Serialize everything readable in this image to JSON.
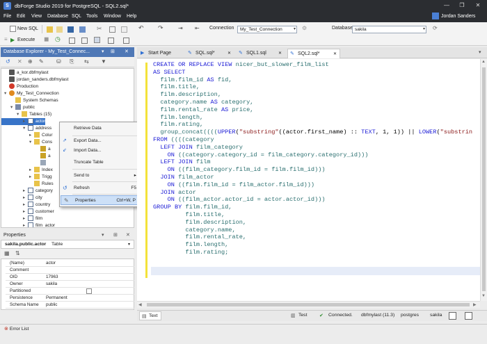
{
  "window": {
    "title": "dbForge Studio 2019 for PostgreSQL - SQL2.sql*",
    "app_icon": "S",
    "controls": [
      "—",
      "❐",
      "✕"
    ]
  },
  "menu": [
    "File",
    "Edit",
    "View",
    "Database",
    "SQL",
    "Tools",
    "Window",
    "Help"
  ],
  "user": {
    "name": "Jordan Sanders"
  },
  "toolbar": {
    "new_sql": "New SQL",
    "execute": "Execute",
    "connection_label": "Connection",
    "connection_value": "My_Test_Connection",
    "database_label": "Database",
    "database_value": "sakila"
  },
  "explorer": {
    "title": "Database Explorer - My_Test_Connec...",
    "tree": [
      {
        "label": "a_kor.dbfmylast",
        "indent": 0,
        "icon": "server",
        "expand": ""
      },
      {
        "label": "jordan_sanders.dbfmylast",
        "indent": 0,
        "icon": "server",
        "expand": ""
      },
      {
        "label": "Production",
        "indent": 0,
        "icon": "server-red",
        "expand": ""
      },
      {
        "label": "My_Test_Connection",
        "indent": 0,
        "icon": "server-orange",
        "expand": "▾"
      },
      {
        "label": "System Schemas",
        "indent": 1,
        "icon": "folder",
        "expand": ""
      },
      {
        "label": "public",
        "indent": 1,
        "icon": "schema",
        "expand": "▾"
      },
      {
        "label": "Tables (15)",
        "indent": 2,
        "icon": "folder",
        "expand": "▾"
      },
      {
        "label": "actor",
        "indent": 3,
        "icon": "table",
        "expand": "▸",
        "selected": true
      },
      {
        "label": "address",
        "indent": 3,
        "icon": "table",
        "expand": "▾"
      },
      {
        "label": "Colur",
        "indent": 4,
        "icon": "folder",
        "expand": "▸"
      },
      {
        "label": "Cons",
        "indent": 4,
        "icon": "folder",
        "expand": "▾"
      },
      {
        "label": "a",
        "indent": 5,
        "icon": "key",
        "expand": ""
      },
      {
        "label": "a",
        "indent": 5,
        "icon": "key",
        "expand": ""
      },
      {
        "label": "",
        "indent": 5,
        "icon": "fk",
        "expand": ""
      },
      {
        "label": "Index",
        "indent": 4,
        "icon": "folder",
        "expand": "▸"
      },
      {
        "label": "Trigg",
        "indent": 4,
        "icon": "folder",
        "expand": "▸"
      },
      {
        "label": "Rules",
        "indent": 4,
        "icon": "folder",
        "expand": ""
      },
      {
        "label": "category",
        "indent": 3,
        "icon": "table",
        "expand": "▸"
      },
      {
        "label": "city",
        "indent": 3,
        "icon": "table",
        "expand": "▸"
      },
      {
        "label": "country",
        "indent": 3,
        "icon": "table",
        "expand": "▸"
      },
      {
        "label": "customer",
        "indent": 3,
        "icon": "table",
        "expand": "▸"
      },
      {
        "label": "film",
        "indent": 3,
        "icon": "table",
        "expand": "▸"
      },
      {
        "label": "film_actor",
        "indent": 3,
        "icon": "table",
        "expand": "▸"
      }
    ]
  },
  "context_menu": [
    {
      "label": "Retrieve Data",
      "shortcut": ""
    },
    {
      "label": "Export Data...",
      "shortcut": ""
    },
    {
      "label": "Import Data...",
      "shortcut": ""
    },
    {
      "label": "Truncate Table",
      "shortcut": ""
    },
    {
      "label": "Send to",
      "shortcut": "▸"
    },
    {
      "label": "Refresh",
      "shortcut": "F5"
    },
    {
      "label": "Properties",
      "shortcut": "Ctrl+W, P"
    }
  ],
  "properties": {
    "title": "Properties",
    "object": "sakila.public.actor",
    "object_type": "Table",
    "rows": [
      {
        "key": "(Name)",
        "value": "actor"
      },
      {
        "key": "Comment",
        "value": ""
      },
      {
        "key": "OID",
        "value": "17963"
      },
      {
        "key": "Owner",
        "value": "sakila"
      },
      {
        "key": "Partitioned",
        "value": ""
      },
      {
        "key": "Persistence",
        "value": "Permanent"
      },
      {
        "key": "Schema Name",
        "value": "public"
      }
    ]
  },
  "tabs": [
    {
      "label": "Start Page",
      "active": false
    },
    {
      "label": "SQL.sql*",
      "active": false
    },
    {
      "label": "SQL1.sql",
      "active": false
    },
    {
      "label": "SQL2.sql*",
      "active": true
    }
  ],
  "code_lines": [
    [
      [
        "kw",
        "CREATE OR REPLACE VIEW "
      ],
      [
        "ct",
        "nicer_but_slower_film_list"
      ]
    ],
    [
      [
        "kw",
        "AS SELECT"
      ]
    ],
    [
      [
        "id",
        "  "
      ],
      [
        "ct",
        "film.film_id "
      ],
      [
        "kw",
        "AS "
      ],
      [
        "ct",
        "fid,"
      ]
    ],
    [
      [
        "id",
        "  "
      ],
      [
        "ct",
        "film.title,"
      ]
    ],
    [
      [
        "id",
        "  "
      ],
      [
        "ct",
        "film.description,"
      ]
    ],
    [
      [
        "id",
        "  "
      ],
      [
        "ct",
        "category.name "
      ],
      [
        "kw",
        "AS "
      ],
      [
        "ct",
        "category,"
      ]
    ],
    [
      [
        "id",
        "  "
      ],
      [
        "ct",
        "film.rental_rate "
      ],
      [
        "kw",
        "AS "
      ],
      [
        "ct",
        "price,"
      ]
    ],
    [
      [
        "id",
        "  "
      ],
      [
        "ct",
        "film.length,"
      ]
    ],
    [
      [
        "id",
        "  "
      ],
      [
        "ct",
        "film.rating,"
      ]
    ],
    [
      [
        "id",
        "  "
      ],
      [
        "ct",
        "group_concat(((("
      ],
      [
        "kw",
        "UPPER"
      ],
      [
        "id",
        "("
      ],
      [
        "st",
        "\"substring\""
      ],
      [
        "id",
        "((actor.first_name) :: "
      ],
      [
        "kw",
        "TEXT"
      ],
      [
        "id",
        ", 1, 1)) || "
      ],
      [
        "kw",
        "LOWER"
      ],
      [
        "id",
        "("
      ],
      [
        "st",
        "\"substrin"
      ]
    ],
    [
      [
        "kw",
        "FROM "
      ],
      [
        "ct",
        "((((category"
      ]
    ],
    [
      [
        "id",
        "  "
      ],
      [
        "kw",
        "LEFT JOIN "
      ],
      [
        "ct",
        "film_category"
      ]
    ],
    [
      [
        "id",
        "    "
      ],
      [
        "kw",
        "ON "
      ],
      [
        "ct",
        "((category.category_id = film_category.category_id)))"
      ]
    ],
    [
      [
        "id",
        "  "
      ],
      [
        "kw",
        "LEFT JOIN "
      ],
      [
        "ct",
        "film"
      ]
    ],
    [
      [
        "id",
        "    "
      ],
      [
        "kw",
        "ON "
      ],
      [
        "ct",
        "((film_category.film_id = film.film_id)))"
      ]
    ],
    [
      [
        "id",
        "  "
      ],
      [
        "kw",
        "JOIN "
      ],
      [
        "ct",
        "film_actor"
      ]
    ],
    [
      [
        "id",
        "    "
      ],
      [
        "kw",
        "ON "
      ],
      [
        "ct",
        "((film.film_id = film_actor.film_id)))"
      ]
    ],
    [
      [
        "id",
        "  "
      ],
      [
        "kw",
        "JOIN "
      ],
      [
        "ct",
        "actor"
      ]
    ],
    [
      [
        "id",
        "    "
      ],
      [
        "kw",
        "ON "
      ],
      [
        "ct",
        "((film_actor.actor_id = actor.actor_id)))"
      ]
    ],
    [
      [
        "kw",
        "GROUP BY "
      ],
      [
        "ct",
        "film.film_id,"
      ]
    ],
    [
      [
        "id",
        "         "
      ],
      [
        "ct",
        "film.title,"
      ]
    ],
    [
      [
        "id",
        "         "
      ],
      [
        "ct",
        "film.description,"
      ]
    ],
    [
      [
        "id",
        "         "
      ],
      [
        "ct",
        "category.name,"
      ]
    ],
    [
      [
        "id",
        "         "
      ],
      [
        "ct",
        "film.rental_rate,"
      ]
    ],
    [
      [
        "id",
        "         "
      ],
      [
        "ct",
        "film.length,"
      ]
    ],
    [
      [
        "id",
        "         "
      ],
      [
        "ct",
        "film.rating;"
      ]
    ]
  ],
  "status": {
    "text_tab": "Text",
    "test": "Test",
    "connected": "Connected.",
    "server": "dbfmylast (11.3)",
    "user": "postgres",
    "db": "sakila"
  },
  "bottom": {
    "error_list": "Error List"
  },
  "colors": {
    "accent": "#3874c8",
    "header": "#4f78b6",
    "keyword": "#1c1cd6",
    "identifier": "#2a6f6f"
  }
}
